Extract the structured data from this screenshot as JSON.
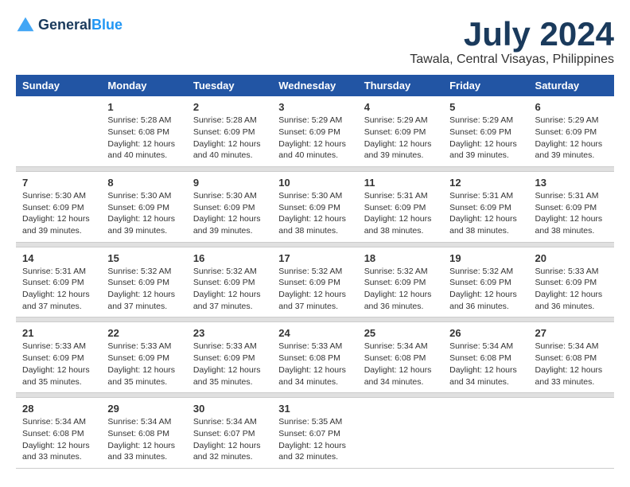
{
  "header": {
    "logo_line1": "General",
    "logo_line2": "Blue",
    "title": "July 2024",
    "subtitle": "Tawala, Central Visayas, Philippines"
  },
  "calendar": {
    "days_of_week": [
      "Sunday",
      "Monday",
      "Tuesday",
      "Wednesday",
      "Thursday",
      "Friday",
      "Saturday"
    ],
    "weeks": [
      [
        {
          "day": "",
          "content": ""
        },
        {
          "day": "1",
          "content": "Sunrise: 5:28 AM\nSunset: 6:08 PM\nDaylight: 12 hours\nand 40 minutes."
        },
        {
          "day": "2",
          "content": "Sunrise: 5:28 AM\nSunset: 6:09 PM\nDaylight: 12 hours\nand 40 minutes."
        },
        {
          "day": "3",
          "content": "Sunrise: 5:29 AM\nSunset: 6:09 PM\nDaylight: 12 hours\nand 40 minutes."
        },
        {
          "day": "4",
          "content": "Sunrise: 5:29 AM\nSunset: 6:09 PM\nDaylight: 12 hours\nand 39 minutes."
        },
        {
          "day": "5",
          "content": "Sunrise: 5:29 AM\nSunset: 6:09 PM\nDaylight: 12 hours\nand 39 minutes."
        },
        {
          "day": "6",
          "content": "Sunrise: 5:29 AM\nSunset: 6:09 PM\nDaylight: 12 hours\nand 39 minutes."
        }
      ],
      [
        {
          "day": "7",
          "content": "Sunrise: 5:30 AM\nSunset: 6:09 PM\nDaylight: 12 hours\nand 39 minutes."
        },
        {
          "day": "8",
          "content": "Sunrise: 5:30 AM\nSunset: 6:09 PM\nDaylight: 12 hours\nand 39 minutes."
        },
        {
          "day": "9",
          "content": "Sunrise: 5:30 AM\nSunset: 6:09 PM\nDaylight: 12 hours\nand 39 minutes."
        },
        {
          "day": "10",
          "content": "Sunrise: 5:30 AM\nSunset: 6:09 PM\nDaylight: 12 hours\nand 38 minutes."
        },
        {
          "day": "11",
          "content": "Sunrise: 5:31 AM\nSunset: 6:09 PM\nDaylight: 12 hours\nand 38 minutes."
        },
        {
          "day": "12",
          "content": "Sunrise: 5:31 AM\nSunset: 6:09 PM\nDaylight: 12 hours\nand 38 minutes."
        },
        {
          "day": "13",
          "content": "Sunrise: 5:31 AM\nSunset: 6:09 PM\nDaylight: 12 hours\nand 38 minutes."
        }
      ],
      [
        {
          "day": "14",
          "content": "Sunrise: 5:31 AM\nSunset: 6:09 PM\nDaylight: 12 hours\nand 37 minutes."
        },
        {
          "day": "15",
          "content": "Sunrise: 5:32 AM\nSunset: 6:09 PM\nDaylight: 12 hours\nand 37 minutes."
        },
        {
          "day": "16",
          "content": "Sunrise: 5:32 AM\nSunset: 6:09 PM\nDaylight: 12 hours\nand 37 minutes."
        },
        {
          "day": "17",
          "content": "Sunrise: 5:32 AM\nSunset: 6:09 PM\nDaylight: 12 hours\nand 37 minutes."
        },
        {
          "day": "18",
          "content": "Sunrise: 5:32 AM\nSunset: 6:09 PM\nDaylight: 12 hours\nand 36 minutes."
        },
        {
          "day": "19",
          "content": "Sunrise: 5:32 AM\nSunset: 6:09 PM\nDaylight: 12 hours\nand 36 minutes."
        },
        {
          "day": "20",
          "content": "Sunrise: 5:33 AM\nSunset: 6:09 PM\nDaylight: 12 hours\nand 36 minutes."
        }
      ],
      [
        {
          "day": "21",
          "content": "Sunrise: 5:33 AM\nSunset: 6:09 PM\nDaylight: 12 hours\nand 35 minutes."
        },
        {
          "day": "22",
          "content": "Sunrise: 5:33 AM\nSunset: 6:09 PM\nDaylight: 12 hours\nand 35 minutes."
        },
        {
          "day": "23",
          "content": "Sunrise: 5:33 AM\nSunset: 6:09 PM\nDaylight: 12 hours\nand 35 minutes."
        },
        {
          "day": "24",
          "content": "Sunrise: 5:33 AM\nSunset: 6:08 PM\nDaylight: 12 hours\nand 34 minutes."
        },
        {
          "day": "25",
          "content": "Sunrise: 5:34 AM\nSunset: 6:08 PM\nDaylight: 12 hours\nand 34 minutes."
        },
        {
          "day": "26",
          "content": "Sunrise: 5:34 AM\nSunset: 6:08 PM\nDaylight: 12 hours\nand 34 minutes."
        },
        {
          "day": "27",
          "content": "Sunrise: 5:34 AM\nSunset: 6:08 PM\nDaylight: 12 hours\nand 33 minutes."
        }
      ],
      [
        {
          "day": "28",
          "content": "Sunrise: 5:34 AM\nSunset: 6:08 PM\nDaylight: 12 hours\nand 33 minutes."
        },
        {
          "day": "29",
          "content": "Sunrise: 5:34 AM\nSunset: 6:08 PM\nDaylight: 12 hours\nand 33 minutes."
        },
        {
          "day": "30",
          "content": "Sunrise: 5:34 AM\nSunset: 6:07 PM\nDaylight: 12 hours\nand 32 minutes."
        },
        {
          "day": "31",
          "content": "Sunrise: 5:35 AM\nSunset: 6:07 PM\nDaylight: 12 hours\nand 32 minutes."
        },
        {
          "day": "",
          "content": ""
        },
        {
          "day": "",
          "content": ""
        },
        {
          "day": "",
          "content": ""
        }
      ]
    ]
  }
}
